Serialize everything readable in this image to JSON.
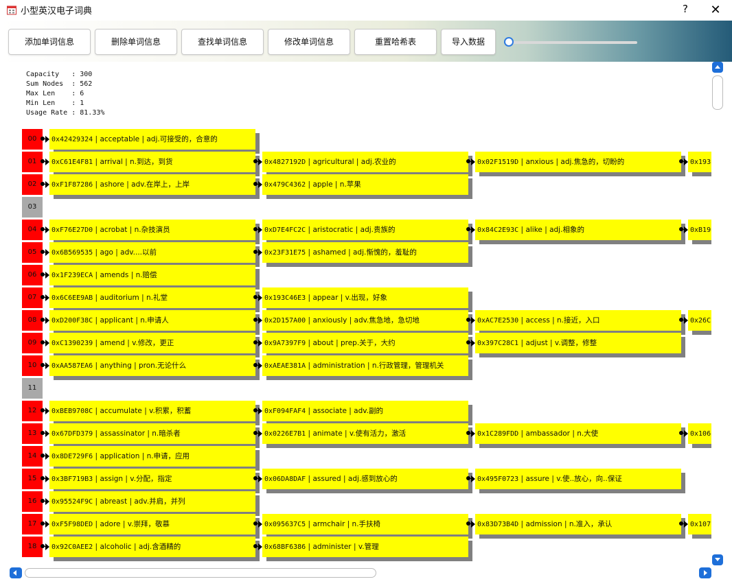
{
  "window": {
    "title": "小型英汉电子词典",
    "help": "?",
    "close": "✕"
  },
  "toolbar": {
    "buttons": [
      "添加单词信息",
      "删除单词信息",
      "查找单词信息",
      "修改单词信息",
      "重置哈希表",
      "导入数据"
    ],
    "slider_value": 0.0
  },
  "stats": {
    "capacity": "Capacity   : 300",
    "sum_nodes": "Sum Nodes  : 562",
    "max_len": "Max Len    : 6",
    "min_len": "Min Len    : 1",
    "usage_rate": "Usage Rate : 81.33%"
  },
  "rows": [
    {
      "index": "00",
      "nodes": [
        {
          "hex": "0x42429324",
          "text": "acceptable | adj.可接受的，合意的"
        }
      ]
    },
    {
      "index": "01",
      "nodes": [
        {
          "hex": "0xC61E4F81",
          "text": "arrival | n.到达，到货"
        },
        {
          "hex": "0x4827192D",
          "text": "agricultural | adj.农业的"
        },
        {
          "hex": "0x02F1519D",
          "text": "anxious | adj.焦急的，切盼的"
        },
        {
          "hex": "0x193",
          "text": ""
        }
      ]
    },
    {
      "index": "02",
      "nodes": [
        {
          "hex": "0xF1F87286",
          "text": "ashore | adv.在岸上，上岸"
        },
        {
          "hex": "0x479C4362",
          "text": "apple | n.苹果"
        }
      ]
    },
    {
      "index": "03",
      "nodes": []
    },
    {
      "index": "04",
      "nodes": [
        {
          "hex": "0xF76E27D0",
          "text": "acrobat | n.杂技演员"
        },
        {
          "hex": "0xD7E4FC2C",
          "text": "aristocratic | adj.贵族的"
        },
        {
          "hex": "0x84C2E93C",
          "text": "alike | adj.相象的"
        },
        {
          "hex": "0xB19",
          "text": ""
        }
      ]
    },
    {
      "index": "05",
      "nodes": [
        {
          "hex": "0x6B569535",
          "text": "ago | adv....以前"
        },
        {
          "hex": "0x23F31E75",
          "text": "ashamed | adj.惭愧的，羞耻的"
        }
      ]
    },
    {
      "index": "06",
      "nodes": [
        {
          "hex": "0x1F239ECA",
          "text": "amends | n.赔偿"
        }
      ]
    },
    {
      "index": "07",
      "nodes": [
        {
          "hex": "0x6C6EE9AB",
          "text": "auditorium | n.礼堂"
        },
        {
          "hex": "0x193C46E3",
          "text": "appear | v.出现，好象"
        }
      ]
    },
    {
      "index": "08",
      "nodes": [
        {
          "hex": "0xD200F38C",
          "text": "applicant | n.申请人"
        },
        {
          "hex": "0x2D157A00",
          "text": "anxiously | adv.焦急地，急切地"
        },
        {
          "hex": "0xAC7E2530",
          "text": "access | n.接近，入口"
        },
        {
          "hex": "0x26C",
          "text": ""
        }
      ]
    },
    {
      "index": "09",
      "nodes": [
        {
          "hex": "0xC1390239",
          "text": "amend | v.修改，更正"
        },
        {
          "hex": "0x9A7397F9",
          "text": "about | prep.关于，大约"
        },
        {
          "hex": "0x397C28C1",
          "text": "adjust | v.调整，修整"
        }
      ]
    },
    {
      "index": "10",
      "nodes": [
        {
          "hex": "0xAA587EA6",
          "text": "anything | pron.无论什么"
        },
        {
          "hex": "0xAEAE381A",
          "text": "administration | n.行政管理，管理机关"
        }
      ]
    },
    {
      "index": "11",
      "nodes": []
    },
    {
      "index": "12",
      "nodes": [
        {
          "hex": "0xBEB9708C",
          "text": "accumulate | v.积累，积蓄"
        },
        {
          "hex": "0xF094FAF4",
          "text": "associate | adv.副的"
        }
      ]
    },
    {
      "index": "13",
      "nodes": [
        {
          "hex": "0x67DFD379",
          "text": "assassinator | n.暗杀者"
        },
        {
          "hex": "0x0226E7B1",
          "text": "animate | v.使有活力，激活"
        },
        {
          "hex": "0x1C289FDD",
          "text": "ambassador | n.大使"
        },
        {
          "hex": "0x106",
          "text": ""
        }
      ]
    },
    {
      "index": "14",
      "nodes": [
        {
          "hex": "0x8DE729F6",
          "text": "application | n.申请，应用"
        }
      ]
    },
    {
      "index": "15",
      "nodes": [
        {
          "hex": "0x3BF719B3",
          "text": "assign | v.分配，指定"
        },
        {
          "hex": "0x06DA8DAF",
          "text": "assured | adj.感到放心的"
        },
        {
          "hex": "0x495F0723",
          "text": "assure | v.使..放心，向..保证"
        }
      ]
    },
    {
      "index": "16",
      "nodes": [
        {
          "hex": "0x95524F9C",
          "text": "abreast | adv.并肩，并列"
        }
      ]
    },
    {
      "index": "17",
      "nodes": [
        {
          "hex": "0xF5F98DED",
          "text": "adore | v.崇拜，敬慕"
        },
        {
          "hex": "0x095637C5",
          "text": "armchair | n.手扶椅"
        },
        {
          "hex": "0x83D73B4D",
          "text": "admission | n.准入，承认"
        },
        {
          "hex": "0x107",
          "text": ""
        }
      ]
    },
    {
      "index": "18",
      "nodes": [
        {
          "hex": "0x92C0AEE2",
          "text": "alcoholic | adj.含酒精的"
        },
        {
          "hex": "0x68BF6386",
          "text": "administer | v.管理"
        }
      ]
    }
  ]
}
